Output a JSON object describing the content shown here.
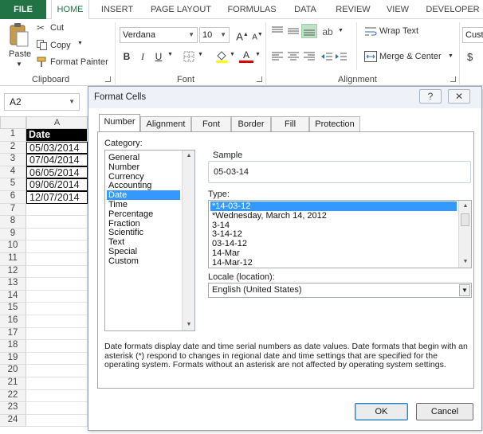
{
  "ribbon_tabs": [
    "FILE",
    "HOME",
    "INSERT",
    "PAGE LAYOUT",
    "FORMULAS",
    "DATA",
    "REVIEW",
    "VIEW",
    "DEVELOPER"
  ],
  "clipboard": {
    "paste_label": "Paste",
    "cut_label": "Cut",
    "copy_label": "Copy",
    "format_painter_label": "Format Painter",
    "group_label": "Clipboard"
  },
  "font": {
    "name": "Verdana",
    "size": "10",
    "group_label": "Font"
  },
  "alignment": {
    "wrap_text_label": "Wrap Text",
    "merge_label": "Merge & Center",
    "group_label": "Alignment"
  },
  "number": {
    "format_partial": "Cust",
    "currency_symbol": "$"
  },
  "name_box": {
    "value": "A2"
  },
  "sheet": {
    "column_header": "A",
    "row_numbers": [
      "1",
      "2",
      "3",
      "4",
      "5",
      "6",
      "7",
      "8",
      "9",
      "10",
      "11",
      "12",
      "13",
      "14",
      "15",
      "16",
      "17",
      "18",
      "19",
      "20",
      "21",
      "22",
      "23",
      "24"
    ],
    "cells": [
      "Date",
      "05/03/2014",
      "07/04/2014",
      "06/05/2014",
      "09/06/2014",
      "12/07/2014"
    ]
  },
  "dialog": {
    "title": "Format Cells",
    "help_label": "?",
    "close_label": "✕",
    "tabs": [
      "Number",
      "Alignment",
      "Font",
      "Border",
      "Fill",
      "Protection"
    ],
    "category_label": "Category:",
    "categories": [
      "General",
      "Number",
      "Currency",
      "Accounting",
      "Date",
      "Time",
      "Percentage",
      "Fraction",
      "Scientific",
      "Text",
      "Special",
      "Custom"
    ],
    "selected_category": "Date",
    "sample_label": "Sample",
    "sample_value": "05-03-14",
    "type_label": "Type:",
    "types": [
      "*14-03-12",
      "*Wednesday, March 14, 2012",
      "3-14",
      "3-14-12",
      "03-14-12",
      "14-Mar",
      "14-Mar-12"
    ],
    "selected_type": "*14-03-12",
    "locale_label": "Locale (location):",
    "locale_value": "English (United States)",
    "description": "Date formats display date and time serial numbers as date values.  Date formats that begin with an asterisk (*) respond to changes in regional date and time settings that are specified for the operating system. Formats without an asterisk are not affected by operating system settings.",
    "ok_label": "OK",
    "cancel_label": "Cancel"
  },
  "colors": {
    "excel_green": "#217346",
    "selection_blue": "#3399ff"
  }
}
